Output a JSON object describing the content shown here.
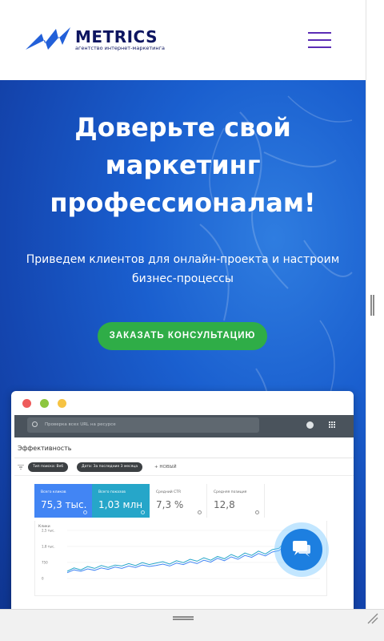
{
  "header": {
    "logo_text": "METRICS",
    "logo_subtitle": "агентство интернет-маркетинга",
    "brand_color": "#0d1560",
    "menu_icon": "hamburger-menu-icon"
  },
  "hero": {
    "title": "Доверьте свой маркетинг профессионалам!",
    "subtitle": "Приведем клиентов для онлайн-проекта и настроим бизнес-процессы",
    "cta_label": "ЗАКАЗАТЬ КОНСУЛЬТАЦИЮ",
    "cta_color": "#2fad47"
  },
  "dashboard": {
    "search_placeholder": "Проверка всех URL на ресурсе",
    "section_title": "Эффективность",
    "filters": [
      {
        "label": "Тип поиска: Веб"
      },
      {
        "label": "Дата: За последние 3 месяца"
      }
    ],
    "new_filter_label": "+ НОВЫЙ",
    "metrics": [
      {
        "label": "Всего кликов",
        "value": "75,3 тыс.",
        "bg": "#4285f4",
        "fg": "#ffffff"
      },
      {
        "label": "Всего показов",
        "value": "1,03 млн",
        "bg": "#26a6c9",
        "fg": "#ffffff"
      },
      {
        "label": "Средний CTR",
        "value": "7,3 %",
        "bg": "#ffffff",
        "fg": "#666666"
      },
      {
        "label": "Средняя позиция",
        "value": "12,8",
        "bg": "#ffffff",
        "fg": "#666666"
      }
    ]
  },
  "chart_data": {
    "type": "line",
    "title": "",
    "ylabel": "Клики",
    "y_ticks": [
      "2,5 тыс.",
      "1,8 тыс.",
      "750",
      "0"
    ],
    "series": [
      {
        "name": "Всего кликов",
        "color": "#4285f4",
        "values": [
          12,
          18,
          15,
          20,
          17,
          22,
          19,
          24,
          21,
          26,
          23,
          28,
          25,
          27,
          30,
          26,
          32,
          29,
          35,
          31,
          38,
          34,
          42,
          37,
          45,
          40,
          48,
          44,
          52,
          47,
          55,
          58,
          70,
          62,
          60,
          65,
          58,
          52
        ]
      },
      {
        "name": "Всего показов",
        "color": "#26a6c9",
        "values": [
          15,
          22,
          18,
          25,
          21,
          27,
          23,
          28,
          26,
          31,
          27,
          33,
          29,
          32,
          35,
          30,
          37,
          33,
          40,
          36,
          43,
          38,
          46,
          41,
          50,
          44,
          53,
          48,
          57,
          51,
          60,
          63,
          78,
          68,
          64,
          70,
          62,
          56
        ]
      }
    ],
    "ylim": [
      0,
      100
    ],
    "grid": true
  },
  "chat": {
    "icon": "chat-bubble-icon"
  }
}
